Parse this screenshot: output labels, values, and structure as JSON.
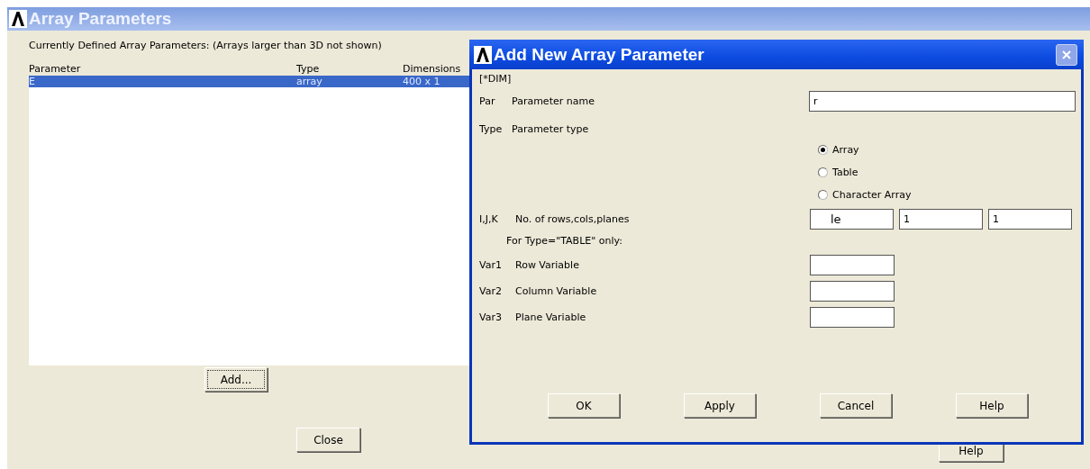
{
  "window": {
    "title": "Array Parameters",
    "caption": "Currently Defined Array Parameters: (Arrays larger than 3D not shown)"
  },
  "table": {
    "columns": [
      "Parameter",
      "Type",
      "Dimensions"
    ],
    "rows": [
      {
        "cells": [
          "E",
          "array",
          "400 x 1"
        ],
        "selected": true
      }
    ]
  },
  "add_button": {
    "label": "Add...",
    "focused": true
  },
  "close_button": {
    "label": "Close"
  },
  "help_button": {
    "label": "Help"
  },
  "dialog": {
    "title": "Add New Array Parameter",
    "close_disabled": true,
    "command": "[*DIM]",
    "rows": [
      {
        "kind": "text",
        "code": "Par",
        "label": "Parameter name",
        "value": "r"
      },
      {
        "kind": "radio",
        "code": "Type",
        "label": "Parameter type",
        "options": [
          {
            "label": "Array",
            "selected": true
          },
          {
            "label": "Table",
            "selected": false
          },
          {
            "label": "Character Array",
            "selected": false
          }
        ]
      },
      {
        "kind": "triple",
        "code": "I,J,K",
        "label": "No. of rows,cols,planes",
        "values": [
          "le",
          "1",
          "1"
        ]
      },
      {
        "kind": "note",
        "label": "For Type=\"TABLE\" only:"
      },
      {
        "kind": "short",
        "code": "Var1",
        "label": "Row Variable"
      },
      {
        "kind": "short",
        "code": "Var2",
        "label": "Column Variable"
      },
      {
        "kind": "short",
        "code": "Var3",
        "label": "Plane Variable"
      }
    ],
    "buttons": [
      "OK",
      "Apply",
      "Cancel",
      "Help"
    ]
  }
}
